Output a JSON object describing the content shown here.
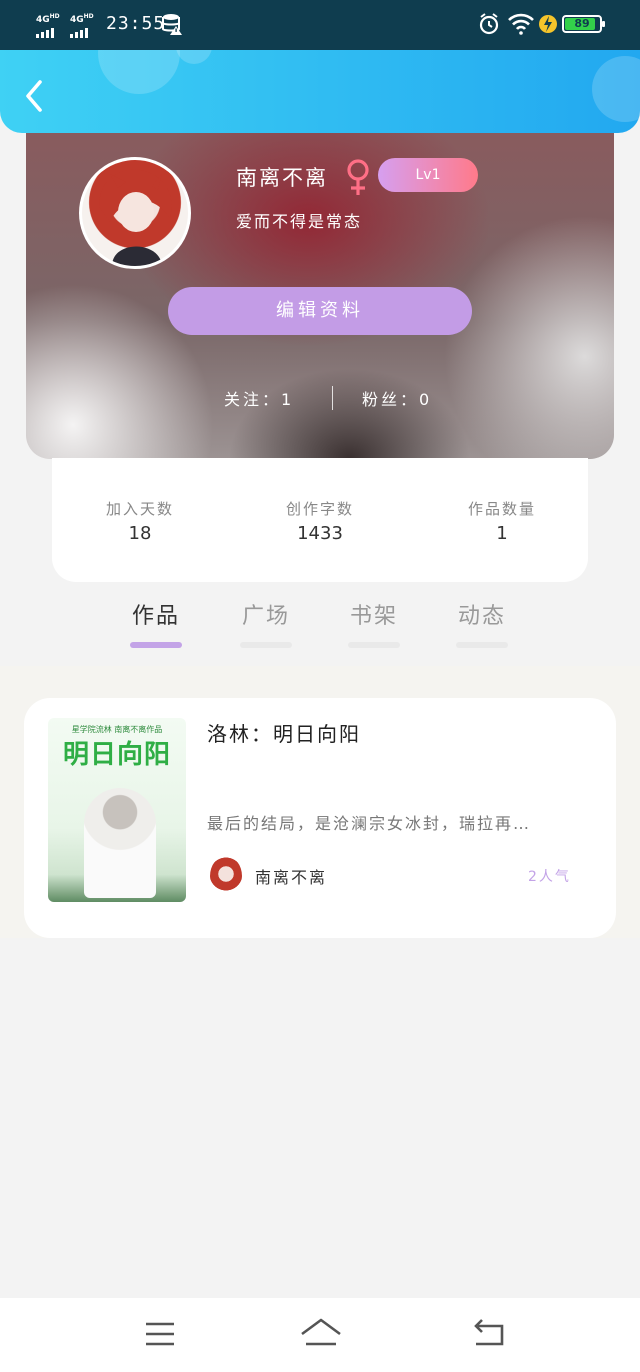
{
  "status_bar": {
    "sim1": "4G",
    "sim1_sup": "HD",
    "sim2": "4G",
    "sim2_sup": "HD",
    "time": "23:55",
    "battery": "89",
    "battery_level": 0.89,
    "icons": [
      "data-saver-icon",
      "alarm-icon",
      "wifi-icon",
      "charging-icon",
      "battery-icon"
    ]
  },
  "header": {
    "back_icon": "chevron-left-icon"
  },
  "profile": {
    "username": "南离不离",
    "gender_icon": "female-icon",
    "level": "Lv1",
    "motto": "爱而不得是常态",
    "edit_button": "编辑资料",
    "follow": "关注：1",
    "fans": "粉丝：0"
  },
  "stats": [
    {
      "label": "加入天数",
      "value": "18"
    },
    {
      "label": "创作字数",
      "value": "1433"
    },
    {
      "label": "作品数量",
      "value": "1"
    }
  ],
  "tabs": [
    {
      "label": "作品",
      "active": true
    },
    {
      "label": "广场",
      "active": false
    },
    {
      "label": "书架",
      "active": false
    },
    {
      "label": "动态",
      "active": false
    }
  ],
  "works": [
    {
      "cover_top_text": "星学院流林  南离不离作品",
      "cover_title": "明日向阳",
      "title": "洛林：明日向阳",
      "description": "最后的结局，是沧澜宗女冰封，瑞拉再…",
      "author": "南离不离",
      "popularity": "2人气"
    }
  ],
  "colors": {
    "header_gradient_start": "#3fd1f4",
    "header_gradient_end": "#22a8f0",
    "accent_purple": "#c3a3e7",
    "edit_button": "#c39ce6",
    "level_gradient_start": "#d69ff0",
    "level_gradient_end": "#ff7a8a",
    "female_icon": "#ff6f86"
  },
  "nav_bar": {
    "icons": [
      "menu-icon",
      "home-icon",
      "back-icon"
    ]
  }
}
